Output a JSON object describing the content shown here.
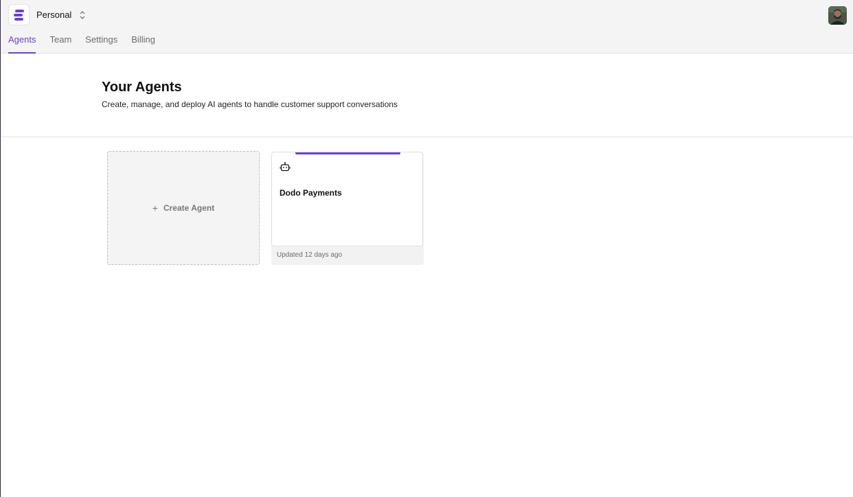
{
  "workspace": {
    "name": "Personal",
    "logo_icon": "brand-logo-icon",
    "switch_icon": "chevron-up-down-icon",
    "accent_color": "#6d3fd6"
  },
  "tabs": [
    {
      "label": "Agents",
      "active": true
    },
    {
      "label": "Team",
      "active": false
    },
    {
      "label": "Settings",
      "active": false
    },
    {
      "label": "Billing",
      "active": false
    }
  ],
  "header": {
    "title": "Your Agents",
    "subtitle": "Create, manage, and deploy AI agents to handle customer support conversations"
  },
  "create_card": {
    "label": "Create Agent",
    "icon": "plus-icon"
  },
  "agents": [
    {
      "name": "Dodo Payments",
      "icon": "robot-icon",
      "updated": "Updated 12 days ago"
    }
  ]
}
